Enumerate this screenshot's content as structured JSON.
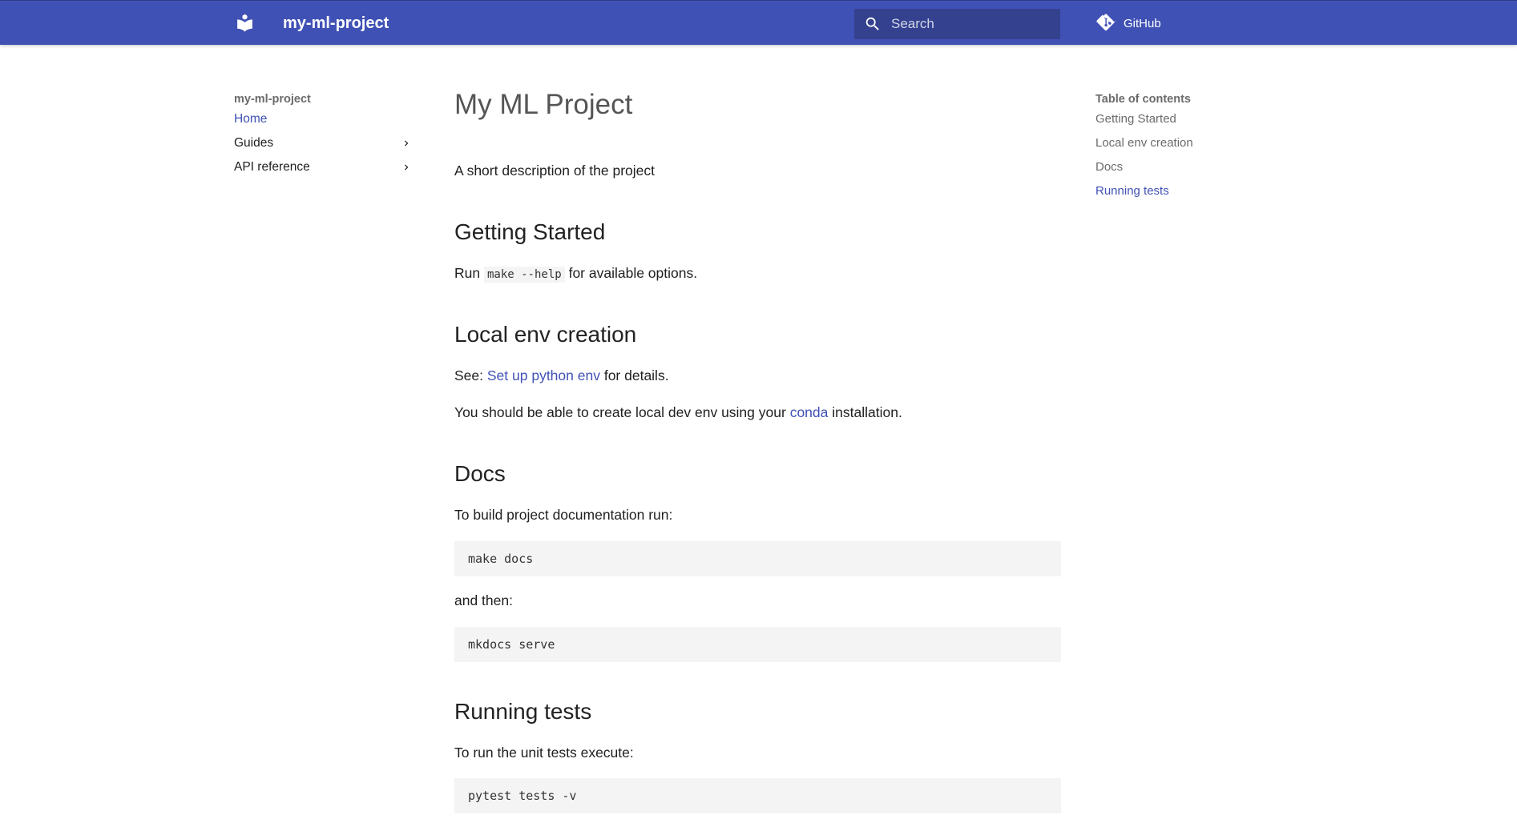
{
  "header": {
    "site_title": "my-ml-project",
    "search_placeholder": "Search",
    "github_label": "GitHub",
    "bg_color": "#4051b5"
  },
  "sidebar": {
    "title": "my-ml-project",
    "items": [
      {
        "label": "Home",
        "active": true,
        "expandable": false
      },
      {
        "label": "Guides",
        "active": false,
        "expandable": true
      },
      {
        "label": "API reference",
        "active": false,
        "expandable": true
      }
    ]
  },
  "content": {
    "title": "My ML Project",
    "description": "A short description of the project",
    "sections": {
      "getting_started": {
        "heading": "Getting Started",
        "text_before": "Run",
        "code": "make --help",
        "text_after": "for available options."
      },
      "local_env": {
        "heading": "Local env creation",
        "p1_before": "See:",
        "p1_link": "Set up python env",
        "p1_after": "for details.",
        "p2_before": "You should be able to create local dev env using your",
        "p2_link": "conda",
        "p2_after": "installation."
      },
      "docs": {
        "heading": "Docs",
        "intro": "To build project documentation run:",
        "code1": "make docs",
        "between": "and then:",
        "code2": "mkdocs serve"
      },
      "tests": {
        "heading": "Running tests",
        "intro": "To run the unit tests execute:",
        "code": "pytest tests -v"
      }
    }
  },
  "toc": {
    "title": "Table of contents",
    "items": [
      {
        "label": "Getting Started",
        "active": false
      },
      {
        "label": "Local env creation",
        "active": false
      },
      {
        "label": "Docs",
        "active": false
      },
      {
        "label": "Running tests",
        "active": true
      }
    ]
  },
  "colors": {
    "accent": "#4051b5",
    "code_bg": "#f4f4f4",
    "muted_text": "#6b6b6b"
  }
}
